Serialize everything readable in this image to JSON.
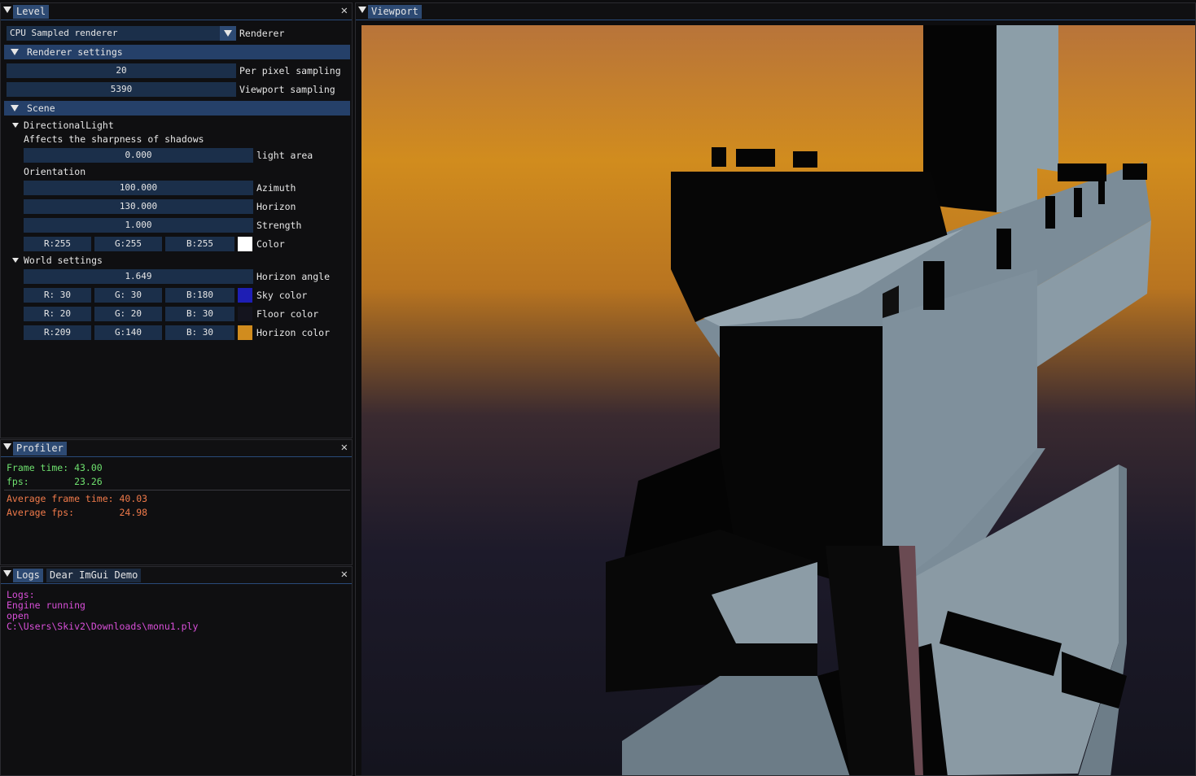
{
  "level": {
    "tab": "Level",
    "renderer_select": "CPU Sampled renderer",
    "renderer_label": "Renderer",
    "renderer_settings_header": "Renderer settings",
    "per_pixel_value": "20",
    "per_pixel_label": "Per pixel sampling",
    "viewport_sampling_value": "5390",
    "viewport_sampling_label": "Viewport sampling",
    "scene_header": "Scene",
    "directional_light": {
      "node": "DirectionalLight",
      "sharpness_text": "Affects the sharpness of shadows",
      "light_area_value": "0.000",
      "light_area_label": "light area",
      "orientation_text": "Orientation",
      "azimuth_value": "100.000",
      "azimuth_label": "Azimuth",
      "horizon_value": "130.000",
      "horizon_label": "Horizon",
      "strength_value": "1.000",
      "strength_label": "Strength",
      "color_r": "R:255",
      "color_g": "G:255",
      "color_b": "B:255",
      "color_label": "Color",
      "color_hex": "#ffffff"
    },
    "world_settings": {
      "node": "World settings",
      "horizon_angle_value": "1.649",
      "horizon_angle_label": "Horizon angle",
      "sky_r": "R: 30",
      "sky_g": "G: 30",
      "sky_b": "B:180",
      "sky_label": "Sky color",
      "sky_hex": "#1e1eb4",
      "floor_r": "R: 20",
      "floor_g": "G: 20",
      "floor_b": "B: 30",
      "floor_label": "Floor color",
      "floor_hex": "#14141e",
      "horizon_r": "R:209",
      "horizon_g": "G:140",
      "horizon_b": "B: 30",
      "horizon_label": "Horizon color",
      "horizon_hex": "#d18c1e"
    }
  },
  "profiler": {
    "tab": "Profiler",
    "frame_time": "Frame time: 43.00",
    "fps": "fps:        23.26",
    "avg_frame_time": "Average frame time: 40.03",
    "avg_fps": "Average fps:        24.98"
  },
  "logs": {
    "tab_logs": "Logs",
    "tab_demo": "Dear ImGui Demo",
    "lines": [
      "Logs:",
      "Engine running",
      "open",
      "C:\\Users\\Skiv2\\Downloads\\monu1.ply"
    ]
  },
  "viewport": {
    "tab": "Viewport"
  },
  "colors": {
    "accent": "#2d4a73",
    "field_bg": "#1b2f4a",
    "profiler_green": "#6ee06e",
    "profiler_orange": "#f07a4a",
    "log_magenta": "#d84fd8"
  }
}
